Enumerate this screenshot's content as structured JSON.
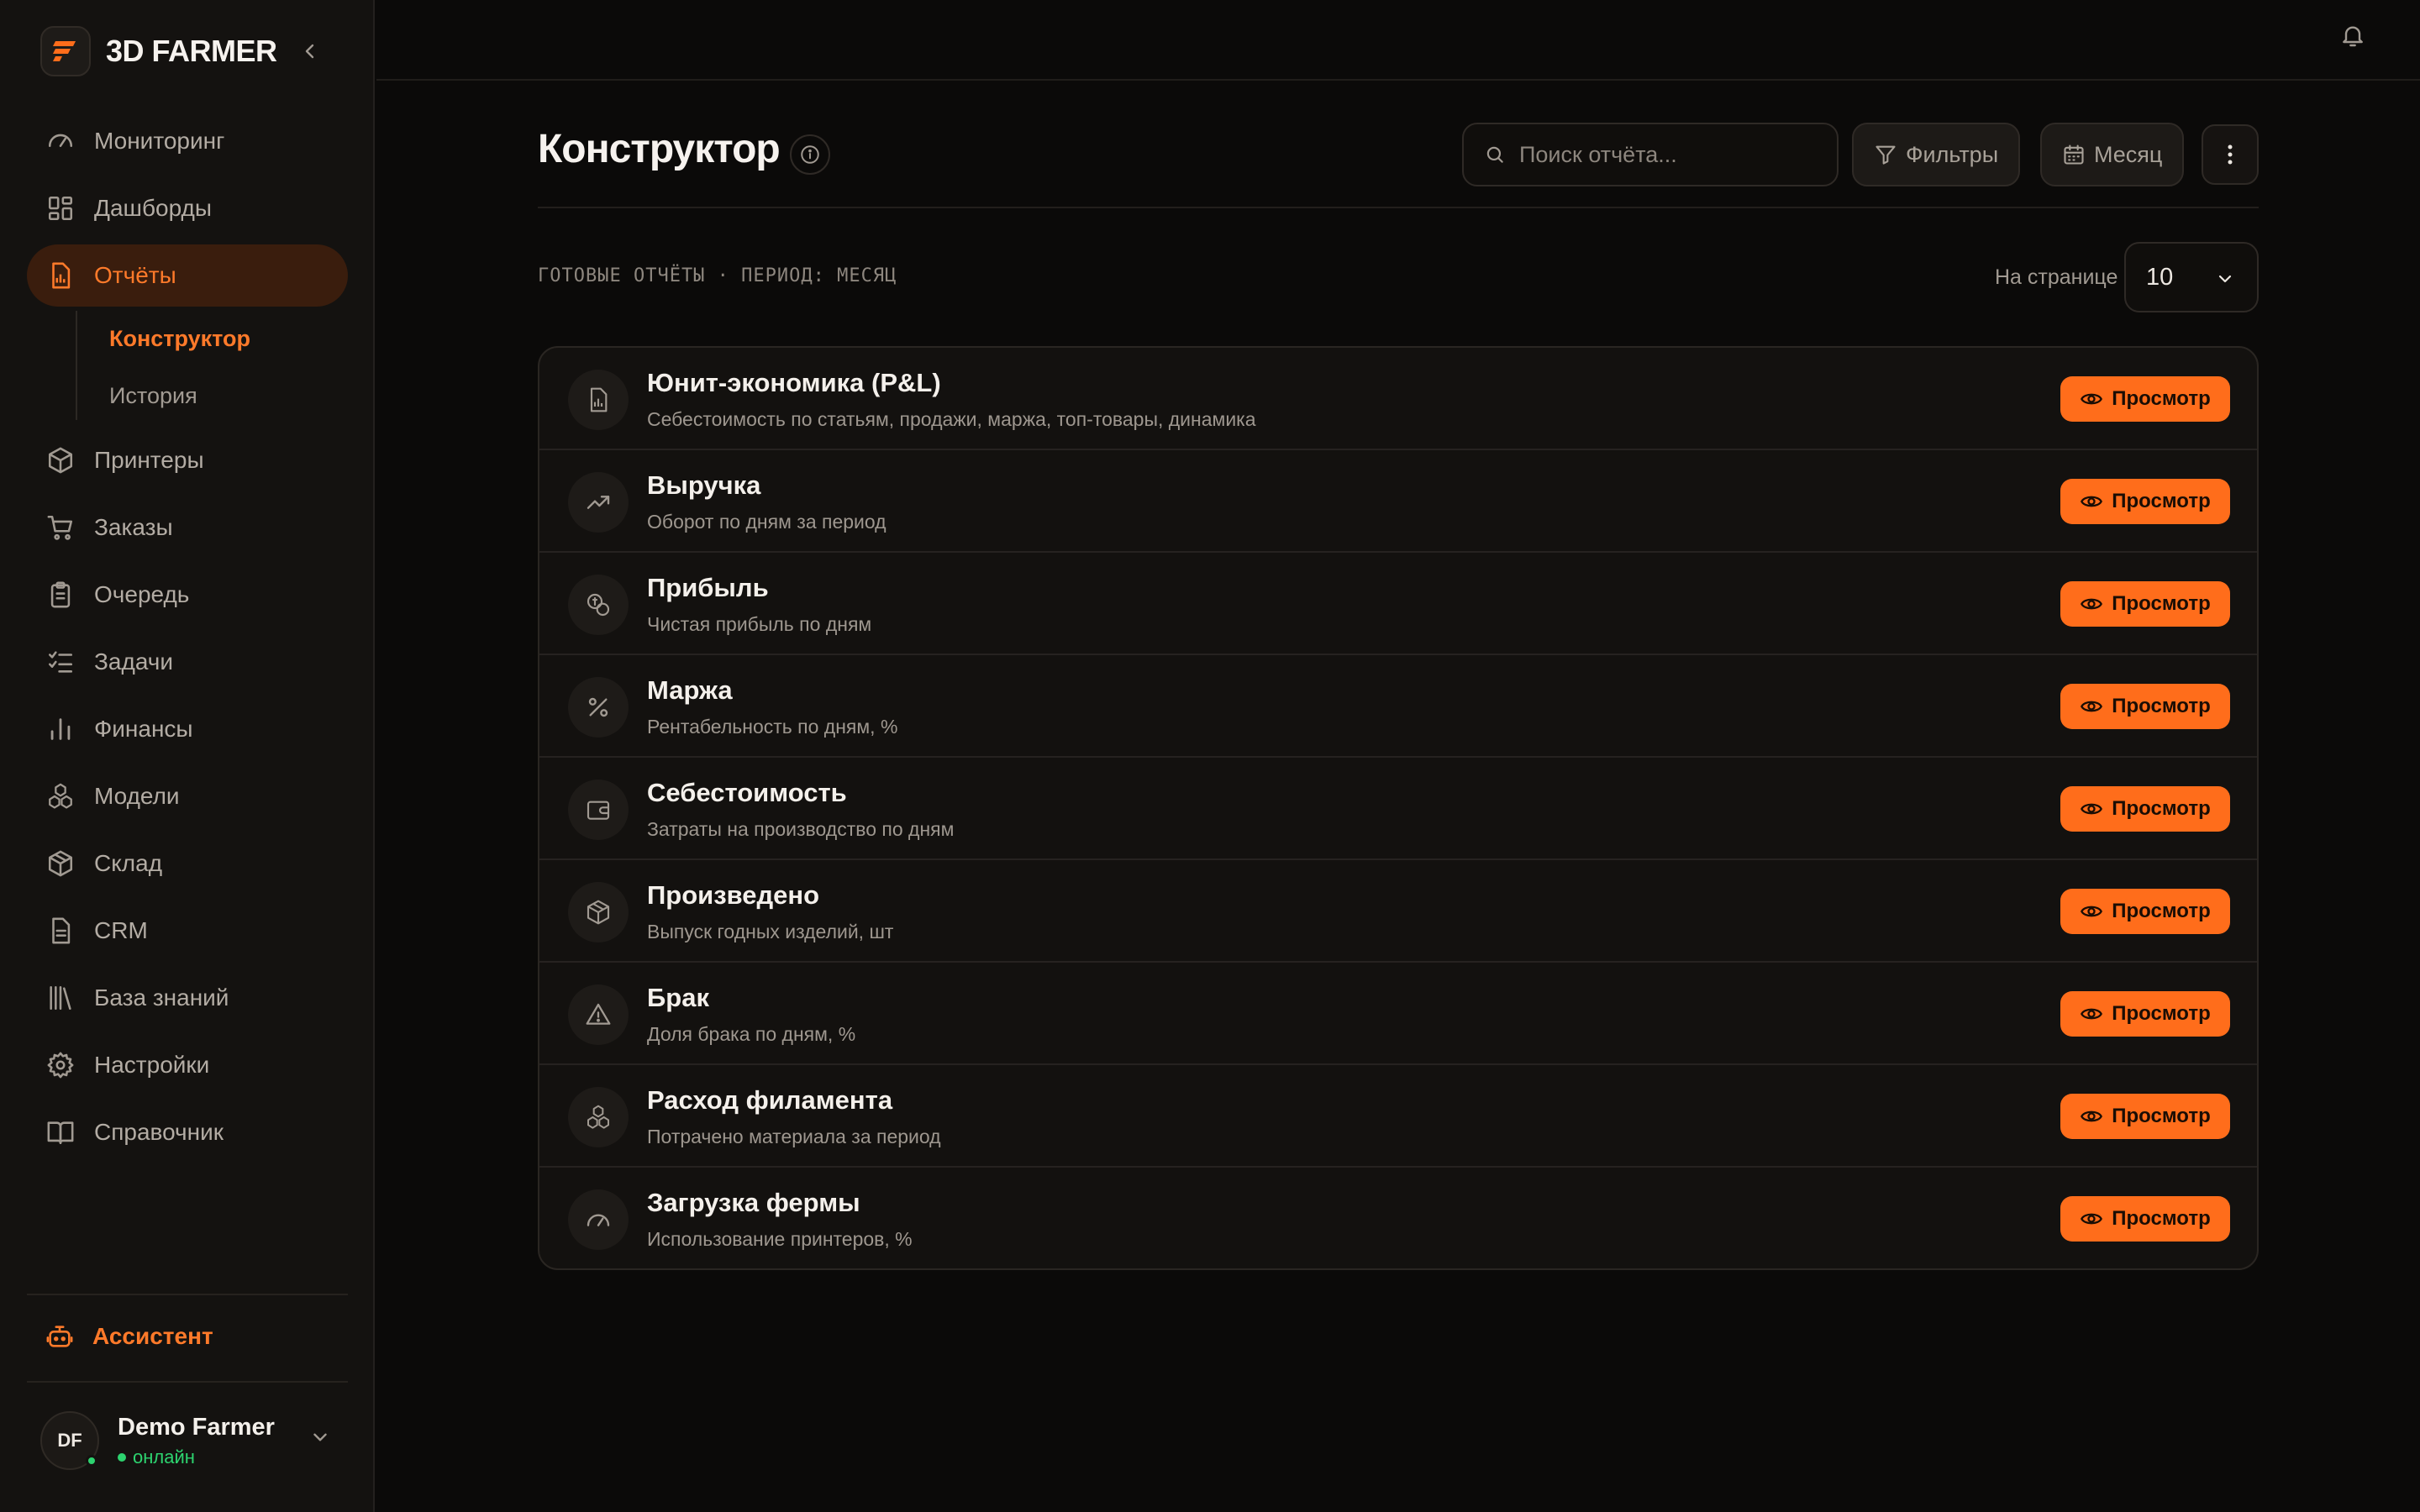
{
  "app": {
    "brand": "3D FARMER",
    "accent_color": "#ff6d1b",
    "online_color": "#2dd36f"
  },
  "sidebar": {
    "items": [
      {
        "label": "Мониторинг",
        "icon": "gauge-icon"
      },
      {
        "label": "Дашборды",
        "icon": "dashboard-grid-icon"
      },
      {
        "label": "Отчёты",
        "icon": "report-file-icon",
        "active": true
      },
      {
        "label": "Принтеры",
        "icon": "box-icon"
      },
      {
        "label": "Заказы",
        "icon": "cart-icon"
      },
      {
        "label": "Очередь",
        "icon": "clipboard-icon"
      },
      {
        "label": "Задачи",
        "icon": "checklist-icon"
      },
      {
        "label": "Финансы",
        "icon": "bar-chart-icon"
      },
      {
        "label": "Модели",
        "icon": "cubes-icon"
      },
      {
        "label": "Склад",
        "icon": "package-icon"
      },
      {
        "label": "CRM",
        "icon": "document-icon"
      },
      {
        "label": "База знаний",
        "icon": "library-icon"
      },
      {
        "label": "Настройки",
        "icon": "gear-icon"
      },
      {
        "label": "Справочник",
        "icon": "book-open-icon"
      }
    ],
    "sub_items": [
      {
        "label": "Конструктор",
        "active": true
      },
      {
        "label": "История"
      }
    ],
    "assistant": "Ассистент",
    "user": {
      "initials": "DF",
      "name": "Demo Farmer",
      "status": "онлайн"
    }
  },
  "main": {
    "title": "Конструктор",
    "search_placeholder": "Поиск отчёта...",
    "filters_label": "Фильтры",
    "period_label": "Месяц",
    "section_label": "ГОТОВЫЕ ОТЧЁТЫ · ПЕРИОД: МЕСЯЦ",
    "per_page_label": "На странице",
    "per_page_value": "10",
    "view_label": "Просмотр",
    "reports": [
      {
        "title": "Юнит-экономика (P&L)",
        "desc": "Себестоимость по статьям, продажи, маржа, топ-товары, динамика",
        "icon": "report-chart-icon"
      },
      {
        "title": "Выручка",
        "desc": "Оборот по дням за период",
        "icon": "trending-up-icon"
      },
      {
        "title": "Прибыль",
        "desc": "Чистая прибыль по дням",
        "icon": "coins-icon"
      },
      {
        "title": "Маржа",
        "desc": "Рентабельность по дням, %",
        "icon": "percent-icon"
      },
      {
        "title": "Себестоимость",
        "desc": "Затраты на производство по дням",
        "icon": "wallet-icon"
      },
      {
        "title": "Произведено",
        "desc": "Выпуск годных изделий, шт",
        "icon": "package-icon"
      },
      {
        "title": "Брак",
        "desc": "Доля брака по дням, %",
        "icon": "warning-icon"
      },
      {
        "title": "Расход филамента",
        "desc": "Потрачено материала за период",
        "icon": "cubes-icon"
      },
      {
        "title": "Загрузка фермы",
        "desc": "Использование принтеров, %",
        "icon": "gauge-icon"
      }
    ]
  }
}
